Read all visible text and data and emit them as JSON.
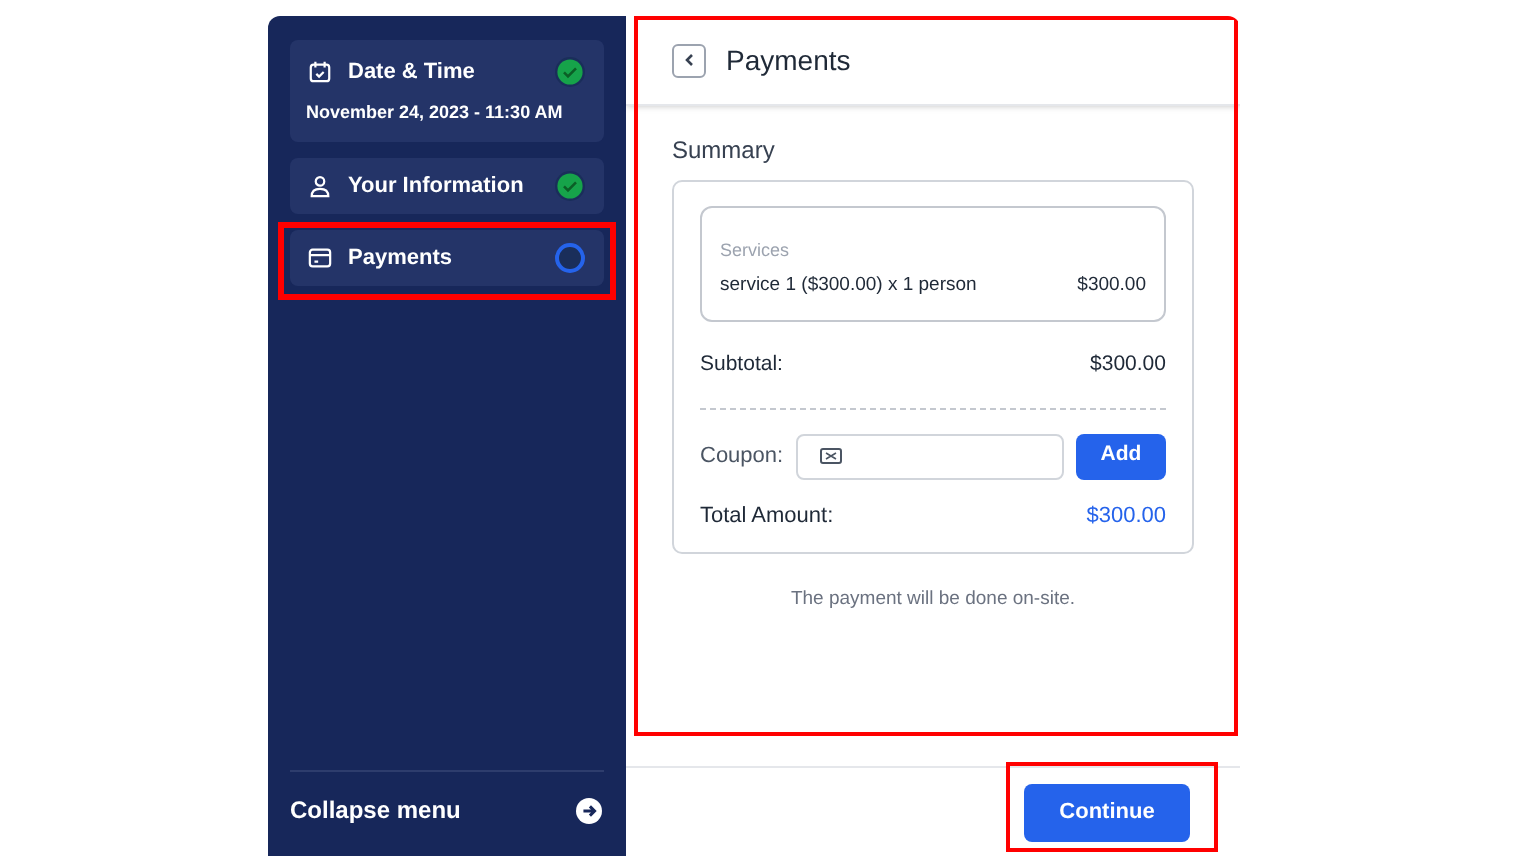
{
  "sidebar": {
    "steps": [
      {
        "title": "Date & Time",
        "detail": "November 24, 2023 - 11:30 AM",
        "completed": true,
        "highlighted": false
      },
      {
        "title": "Your Information",
        "completed": true,
        "highlighted": false
      },
      {
        "title": "Payments",
        "completed": false,
        "highlighted": true
      }
    ],
    "collapse_label": "Collapse menu"
  },
  "panel": {
    "title": "Payments",
    "highlighted": true,
    "summary": {
      "heading": "Summary",
      "services_label": "Services",
      "service": "service 1 ($300.00) x 1 person",
      "service_price": "$300.00",
      "subtotal_label": "Subtotal:",
      "subtotal": "$300.00",
      "coupon_label": "Coupon:",
      "coupon_button": "Add",
      "total_label": "Total Amount:",
      "total": "$300.00"
    },
    "note": "The payment will be done on-site."
  },
  "footer": {
    "continue_button": "Continue",
    "highlighted": true
  }
}
